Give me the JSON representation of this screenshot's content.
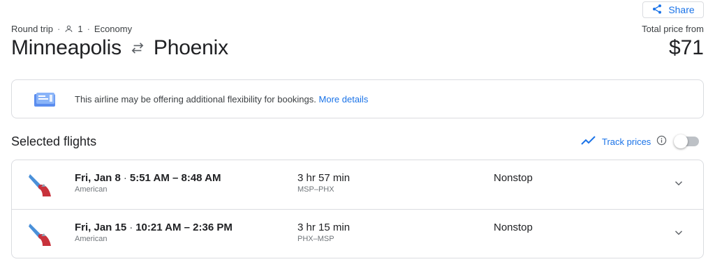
{
  "share": {
    "label": "Share"
  },
  "trip": {
    "type": "Round trip",
    "passengers": "1",
    "cabin": "Economy",
    "origin": "Minneapolis",
    "destination": "Phoenix"
  },
  "price": {
    "label": "Total price from",
    "value": "$71"
  },
  "notice": {
    "text": "This airline may be offering additional flexibility for bookings.",
    "link": "More details"
  },
  "selected": {
    "title": "Selected flights",
    "track_label": "Track prices",
    "track_enabled": false
  },
  "flights": [
    {
      "date": "Fri, Jan 8",
      "times": "5:51 AM – 8:48 AM",
      "airline": "American",
      "duration": "3 hr 57 min",
      "airports": "MSP–PHX",
      "stops": "Nonstop"
    },
    {
      "date": "Fri, Jan 15",
      "times": "10:21 AM – 2:36 PM",
      "airline": "American",
      "duration": "3 hr 15 min",
      "airports": "PHX–MSP",
      "stops": "Nonstop"
    }
  ],
  "colors": {
    "accent": "#1a73e8",
    "text": "#202124",
    "muted": "#70757a",
    "border": "#dadce0",
    "airline_blue": "#4a90d9",
    "airline_red": "#c8323c"
  },
  "icons": {
    "share": "share-icon",
    "person": "person-icon",
    "swap": "swap-arrows-icon",
    "notice": "ticket-icon",
    "track": "trend-line-icon",
    "info": "info-icon",
    "expand": "chevron-down-icon",
    "airline": "american-airlines-logo"
  }
}
